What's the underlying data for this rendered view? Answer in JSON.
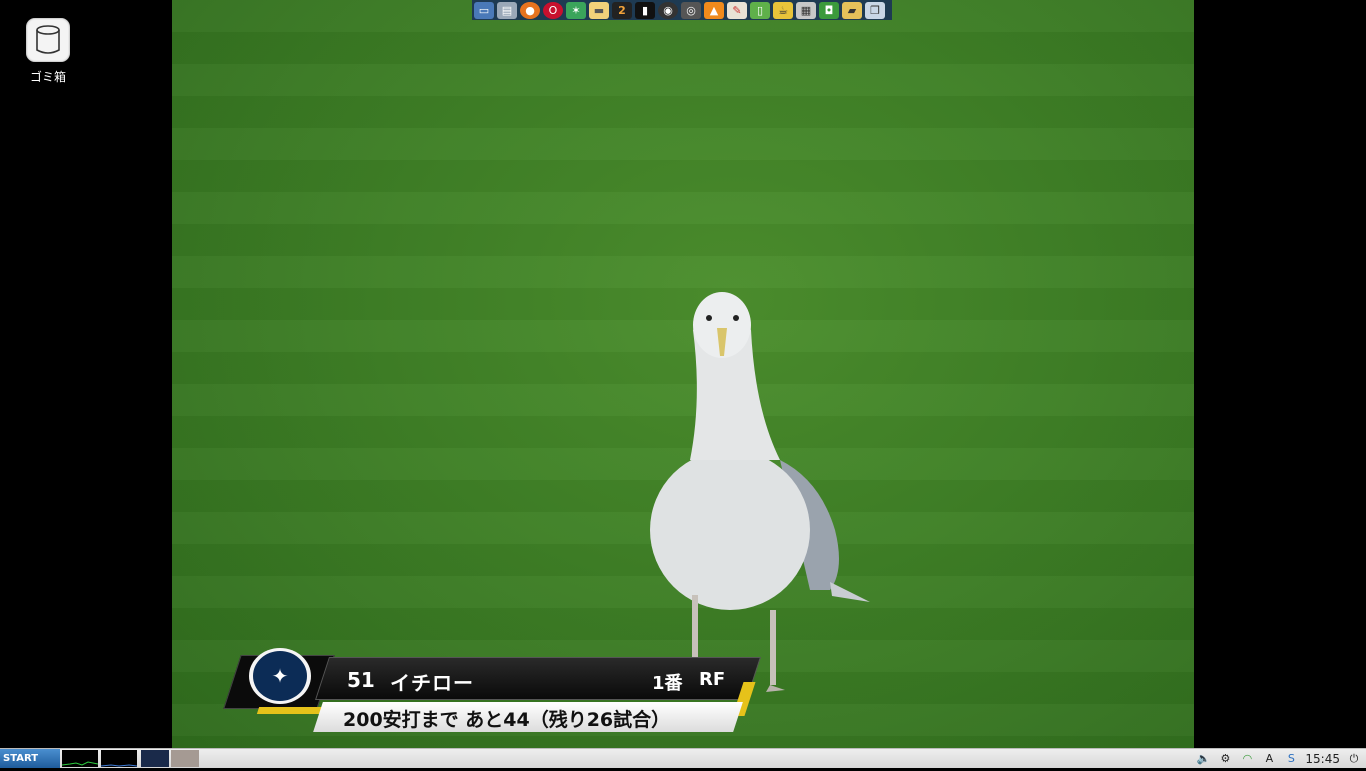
{
  "desktop": {
    "trash_label": "ゴミ箱"
  },
  "dock": {
    "icons": [
      "monitor-icon",
      "disk-icon",
      "firefox-icon",
      "opera-icon",
      "star-app-icon",
      "notes-icon",
      "number-two-app-icon",
      "film-app-icon",
      "webcam-icon",
      "disc-app-icon",
      "vlc-icon",
      "paint-app-icon",
      "document-icon",
      "teapot-icon",
      "calculator-icon",
      "image-app-icon",
      "folder-app-icon",
      "window-app-icon"
    ]
  },
  "broadcast": {
    "player_number": "51",
    "player_name": "イチロー",
    "batting_order": "1番",
    "position": "RF",
    "stat_line": "200安打まで あと44（残り26試合）",
    "team_colors": {
      "navy": "#0c2c56",
      "teal": "#005c5c",
      "accent": "#e6c21a"
    }
  },
  "taskbar": {
    "start_label": "START",
    "clock": "15:45"
  }
}
